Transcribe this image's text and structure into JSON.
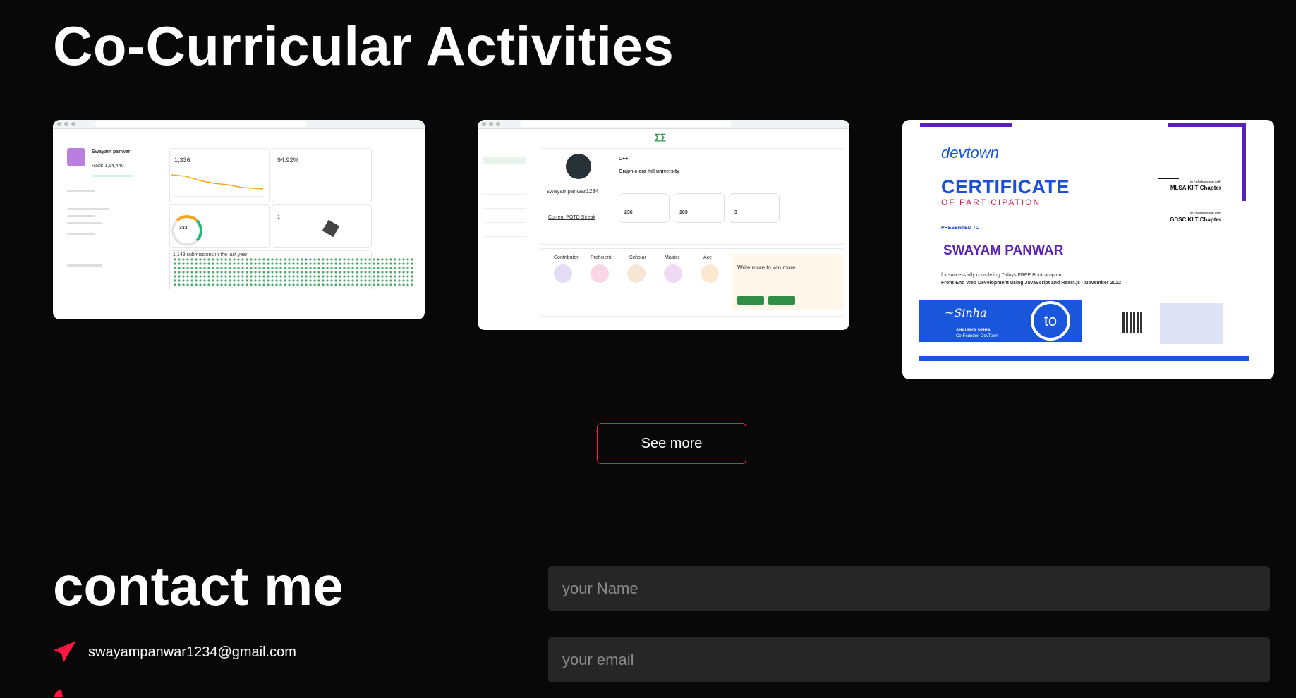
{
  "activities": {
    "title": "Co-Curricular Activities",
    "cards": [
      {
        "kind": "leetcode-profile",
        "username": "Swayam panwar",
        "rank": "Rank 1,54,440",
        "contest_rating": "1,336",
        "top_percent": "94.92%",
        "solved": "333",
        "badges": "1",
        "submissions_text": "1,149 submissions in the last year"
      },
      {
        "kind": "gfg-profile",
        "username": "swayampanwar1234",
        "language": "C++",
        "institute": "Graphic era hill university",
        "coding_score": "236",
        "problems_solved": "103",
        "monthly_score": "3",
        "streak_label": "Current POTD Streak",
        "promo_text": "Write more to win more",
        "badges": [
          "Contributor",
          "Proficient",
          "Scholar",
          "Master",
          "Ace"
        ]
      },
      {
        "kind": "certificate",
        "brand": "devtown",
        "heading": "CERTIFICATE",
        "subheading": "OF PARTICIPATION",
        "presented_to": "PRESENTED TO",
        "name": "SWAYAM PANWAR",
        "desc": "for successfully completing 7-days FREE Bootcamp on",
        "course": "Front-End Web Development using JavaScript and React.js - November 2022",
        "chapter1": "MLSA KIIT Chapter",
        "chapter2": "GDSC KIIT Chapter",
        "collab": "in collaboration with",
        "signer": "SHAURYA SINHA",
        "signer_role": "Co-Founder, DevTown",
        "seal_text": "to"
      }
    ]
  },
  "see_more": {
    "label": "See more"
  },
  "contact": {
    "title": "contact me",
    "email": "swayampanwar1234@gmail.com",
    "name_placeholder": "your Name",
    "email_placeholder": "your email"
  },
  "colors": {
    "accent": "#ff1744",
    "background": "#080808",
    "field": "#262626"
  }
}
